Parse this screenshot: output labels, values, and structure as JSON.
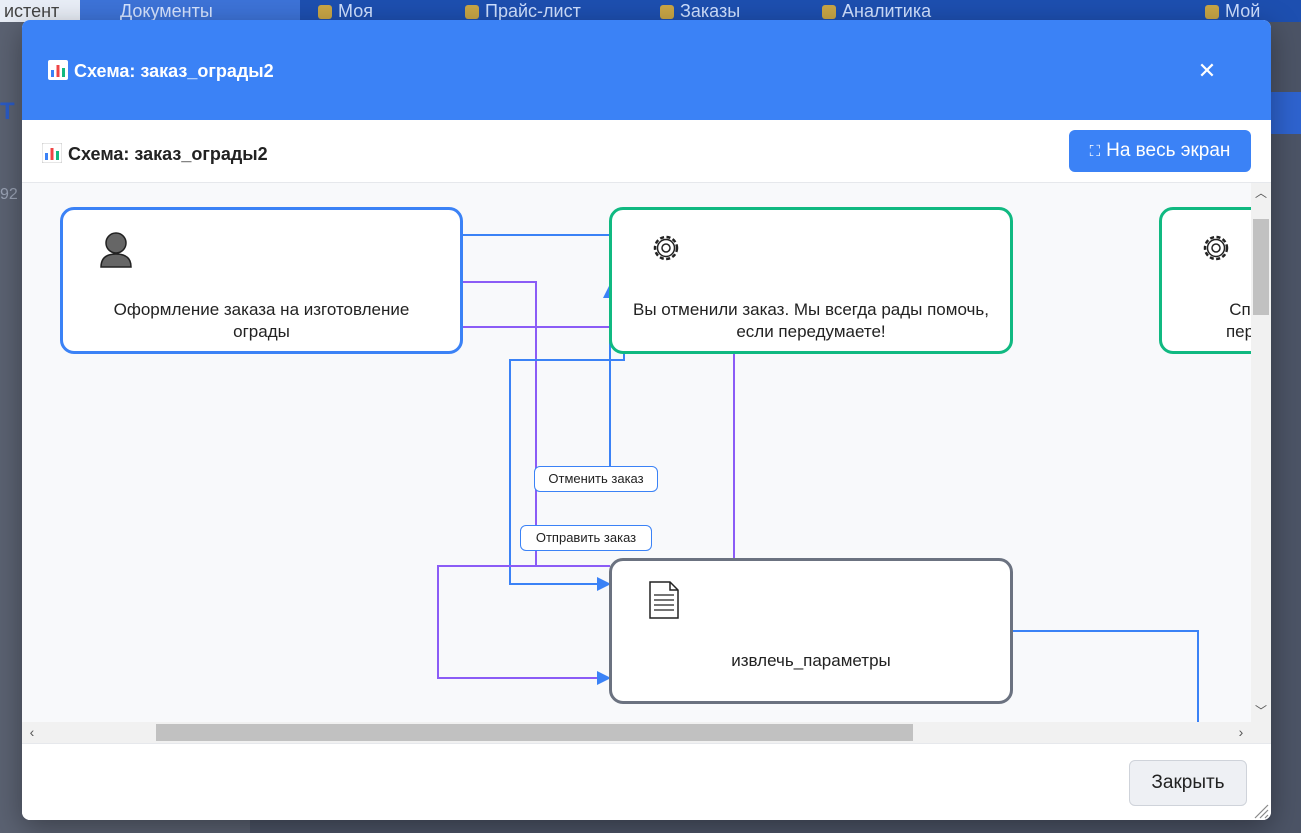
{
  "background_nav": {
    "tabs": [
      "истент",
      "Документы",
      "Моя",
      "Прайс-лист",
      "Заказы",
      "Аналитика",
      "Мой"
    ]
  },
  "background": {
    "side_letter": "Т",
    "side_number": "92 ±"
  },
  "modal": {
    "title": "Схема: заказ_ограды2",
    "close_symbol": "✕"
  },
  "diagram_header": {
    "title": "Схема: заказ_ограды2",
    "fullscreen_label": "На весь экран"
  },
  "nodes": [
    {
      "id": "start",
      "icon": "person-icon",
      "text": "Оформление заказа на изготовление ограды",
      "border": "#3b82f6"
    },
    {
      "id": "cancel",
      "icon": "gear-icon",
      "text": "Вы отменили заказ. Мы всегда рады помочь, если передумаете!",
      "border": "#10b981"
    },
    {
      "id": "partial",
      "icon": "gear-icon",
      "text": "Сп пер",
      "border": "#10b981"
    },
    {
      "id": "extract",
      "icon": "document-icon",
      "text": "извлечь_параметры",
      "border": "#6b7280"
    }
  ],
  "edge_labels": {
    "cancel_order": "Отменить заказ",
    "send_order": "Отправить заказ"
  },
  "colors": {
    "header": "#3b82f6",
    "edge_blue": "#3b82f6",
    "edge_purple": "#8b5cf6"
  },
  "footer": {
    "close_label": "Закрыть"
  }
}
